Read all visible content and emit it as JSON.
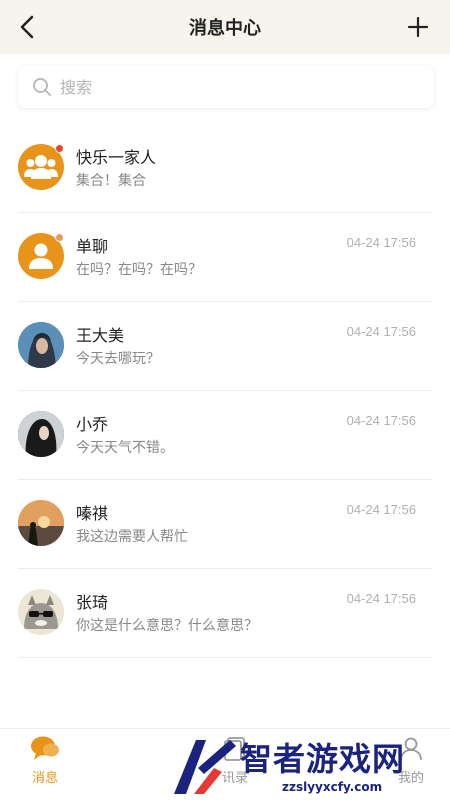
{
  "header": {
    "title": "消息中心",
    "back_icon": "chevron-left-icon",
    "add_icon": "plus-icon"
  },
  "search": {
    "placeholder": "搜索",
    "value": ""
  },
  "conversations": [
    {
      "name": "快乐一家人",
      "message": "集合！集合",
      "time": "",
      "avatar": "group-icon",
      "unread": true
    },
    {
      "name": "单聊",
      "message": "在吗？在吗？在吗？",
      "time": "04-24 17:56",
      "avatar": "person-icon",
      "unread": true
    },
    {
      "name": "王大美",
      "message": "今天去哪玩？",
      "time": "04-24 17:56",
      "avatar": "photo-avatar",
      "unread": false
    },
    {
      "name": "小乔",
      "message": "今天天气不错。",
      "time": "04-24 17:56",
      "avatar": "photo-avatar",
      "unread": false
    },
    {
      "name": "嗪祺",
      "message": "我这边需要人帮忙",
      "time": "04-24 17:56",
      "avatar": "photo-avatar",
      "unread": false
    },
    {
      "name": "张琦",
      "message": "你这是什么意思？什么意思？",
      "time": "04-24 17:56",
      "avatar": "photo-avatar",
      "unread": false
    }
  ],
  "tabbar": {
    "tabs": [
      {
        "label": "消息",
        "active": true
      },
      {
        "label": "讯录",
        "active": false
      },
      {
        "label": "我的",
        "active": false
      }
    ]
  },
  "watermark": {
    "text": "智者游戏网",
    "url": "zzslyyxcfy.com"
  },
  "colors": {
    "accent": "#e8941a",
    "header_bg": "#f7f4ee",
    "unread_dot": "#e8462f"
  }
}
